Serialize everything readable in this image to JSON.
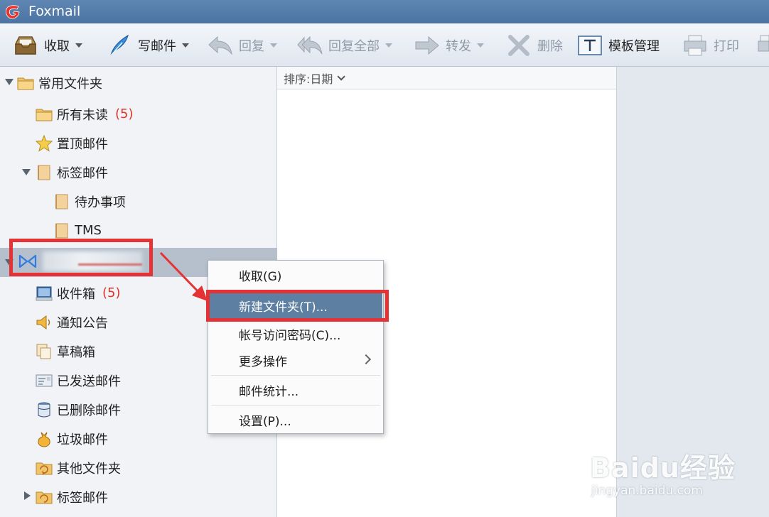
{
  "window": {
    "title": "Foxmail"
  },
  "toolbar": {
    "receive": "收取",
    "compose": "写邮件",
    "reply": "回复",
    "reply_all": "回复全部",
    "forward": "转发",
    "delete": "删除",
    "templates": "模板管理",
    "print": "打印"
  },
  "sidebar": {
    "common_folders": "常用文件夹",
    "all_unread": "所有未读",
    "all_unread_count": "(5)",
    "pinned": "置顶邮件",
    "tagged": "标签邮件",
    "todo": "待办事项",
    "tms": "TMS",
    "inbox": "收件箱",
    "inbox_count": "(5)",
    "notices": "通知公告",
    "drafts": "草稿箱",
    "sent": "已发送邮件",
    "deleted": "已删除邮件",
    "junk": "垃圾邮件",
    "other": "其他文件夹",
    "tagged2": "标签邮件"
  },
  "list": {
    "sort_label": "排序:日期"
  },
  "context_menu": {
    "items": [
      "收取(G)",
      "新建文件夹(T)...",
      "帐号访问密码(C)...",
      "更多操作",
      "邮件统计...",
      "设置(P)..."
    ],
    "selected_index": 1
  },
  "watermark": {
    "main": "Baidu经验",
    "sub": "jingyan.baidu.com"
  },
  "colors": {
    "titlebar": "#5579a6",
    "selected_menu": "#5d7fa2",
    "annotation": "#e53335",
    "unread_count": "#e0332b"
  },
  "icons": [
    "foxmail-logo",
    "inbox-tray-icon",
    "feather-pen-icon",
    "reply-arrow-icon",
    "reply-all-arrow-icon",
    "forward-arrow-icon",
    "delete-x-icon",
    "template-t-icon",
    "printer-icon",
    "folder-icon",
    "star-icon",
    "tag-folder-icon",
    "exchange-account-icon",
    "inbox-monitor-icon",
    "speaker-icon",
    "drafts-icon",
    "sent-icon",
    "trash-bin-icon",
    "junk-bag-icon",
    "other-folder-icon"
  ]
}
